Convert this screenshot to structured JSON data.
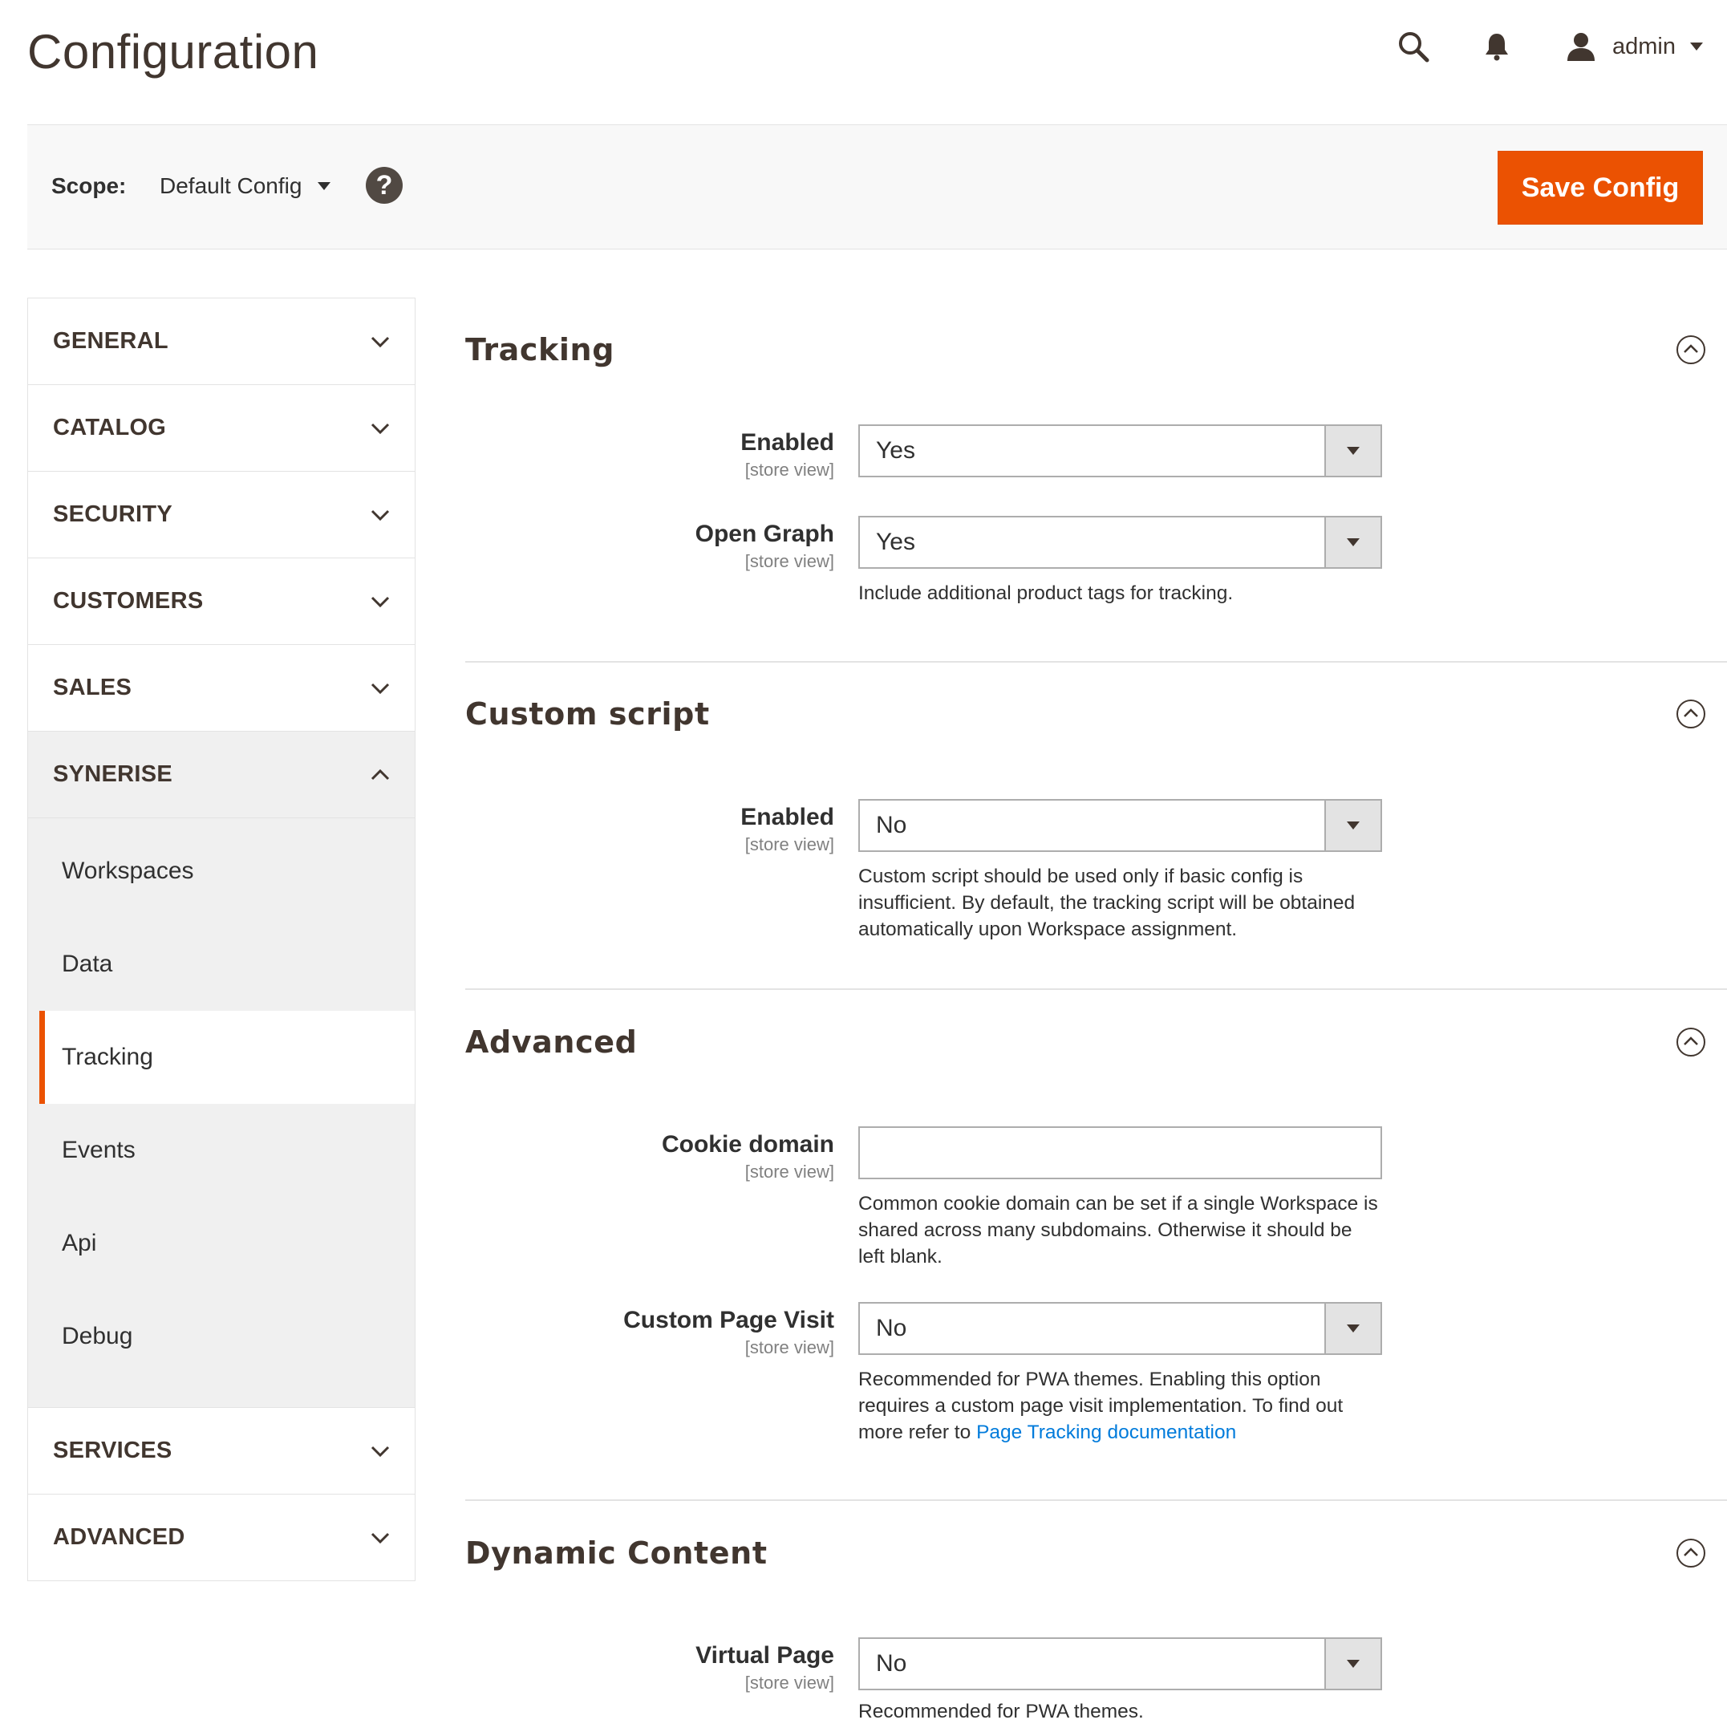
{
  "header": {
    "title": "Configuration",
    "user_name": "admin",
    "icons": [
      "search-icon",
      "bell-icon",
      "user-icon"
    ]
  },
  "scope": {
    "label": "Scope:",
    "value": "Default Config",
    "save_label": "Save Config"
  },
  "colors": {
    "accent": "#eb5202",
    "link": "#007bdb",
    "text": "#303030"
  },
  "sidebar": {
    "tabs": [
      {
        "label": "GENERAL",
        "open": false
      },
      {
        "label": "CATALOG",
        "open": false
      },
      {
        "label": "SECURITY",
        "open": false
      },
      {
        "label": "CUSTOMERS",
        "open": false
      },
      {
        "label": "SALES",
        "open": false
      },
      {
        "label": "SYNERISE",
        "open": true
      }
    ],
    "synerise_items": [
      "Workspaces",
      "Data",
      "Tracking",
      "Events",
      "Api",
      "Debug"
    ],
    "active_item": "Tracking",
    "bottom_tabs": [
      {
        "label": "SERVICES"
      },
      {
        "label": "ADVANCED"
      }
    ]
  },
  "sections": {
    "tracking": {
      "title": "Tracking",
      "enabled": {
        "label": "Enabled",
        "scope": "[store view]",
        "value": "Yes"
      },
      "open_graph": {
        "label": "Open Graph",
        "scope": "[store view]",
        "value": "Yes",
        "note": "Include additional product tags for tracking."
      }
    },
    "custom_script": {
      "title": "Custom script",
      "enabled": {
        "label": "Enabled",
        "scope": "[store view]",
        "value": "No",
        "note": "Custom script should be used only if basic config is insufficient. By default, the tracking script will be obtained automatically upon Workspace assignment."
      }
    },
    "advanced": {
      "title": "Advanced",
      "cookie_domain": {
        "label": "Cookie domain",
        "scope": "[store view]",
        "value": "",
        "note": "Common cookie domain can be set if a single Workspace is shared across many subdomains. Otherwise it should be left blank."
      },
      "custom_page_visit": {
        "label": "Custom Page Visit",
        "scope": "[store view]",
        "value": "No",
        "note": "Recommended for PWA themes. Enabling this option requires a custom page visit implementation. To find out more refer to",
        "link_text": "Page Tracking documentation"
      }
    },
    "dynamic_content": {
      "title": "Dynamic Content",
      "virtual_page": {
        "label": "Virtual Page",
        "scope": "[store view]",
        "value": "No",
        "note": "Recommended for PWA themes."
      }
    }
  }
}
